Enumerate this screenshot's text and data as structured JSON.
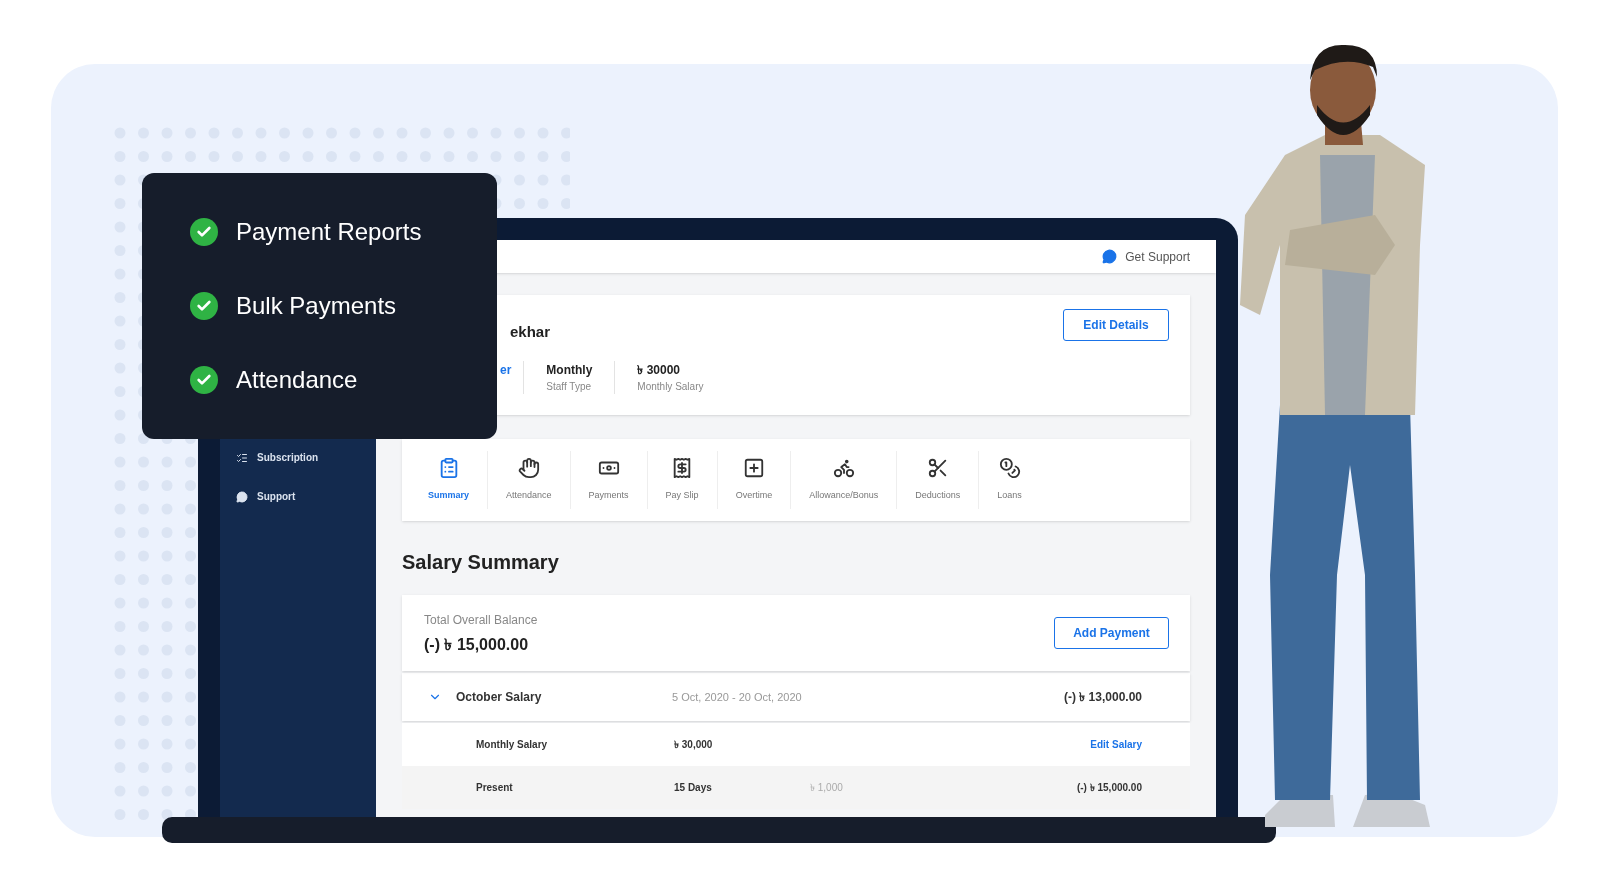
{
  "feature_card": {
    "features": [
      {
        "label": "Payment Reports",
        "checked": true
      },
      {
        "label": "Bulk Payments",
        "checked": true
      },
      {
        "label": "Attendance",
        "checked": true
      }
    ]
  },
  "top_bar": {
    "support_link": "Get Support"
  },
  "sidebar": {
    "items": [
      {
        "label": "Subscription",
        "selected": false
      },
      {
        "label": "Support",
        "selected": false
      }
    ]
  },
  "profile": {
    "name_fragment": "ekhar",
    "role_fragment": "er",
    "edit_button": "Edit Details",
    "stats": [
      {
        "value": "Monthly",
        "label": "Staff Type"
      },
      {
        "value": "৳ 30000",
        "label": "Monthly Salary"
      }
    ]
  },
  "tabs": [
    {
      "label": "Summary",
      "selected": true
    },
    {
      "label": "Attendance",
      "selected": false
    },
    {
      "label": "Payments",
      "selected": false
    },
    {
      "label": "Pay Slip",
      "selected": false
    },
    {
      "label": "Overtime",
      "selected": false
    },
    {
      "label": "Allowance/Bonus",
      "selected": false
    },
    {
      "label": "Deductions",
      "selected": false
    },
    {
      "label": "Loans",
      "selected": false
    }
  ],
  "salary_summary": {
    "title": "Salary Summary",
    "balance_label": "Total Overall Balance",
    "balance": "(-) ৳ 15,000.00",
    "add_button": "Add Payment",
    "period": {
      "title": "October Salary",
      "expanded": true,
      "dates": "5 Oct, 2020 - 20 Oct, 2020",
      "amount": "(-) ৳ 13,000.00"
    },
    "rows": [
      {
        "kind": "editable",
        "label": "Monthly Salary",
        "value": "৳ 30,000",
        "action": "Edit Salary"
      },
      {
        "kind": "detail",
        "label": "Present",
        "value": "15 Days",
        "rate": "৳ 1,000",
        "amount": "(-) ৳ 15,000.00"
      }
    ]
  }
}
